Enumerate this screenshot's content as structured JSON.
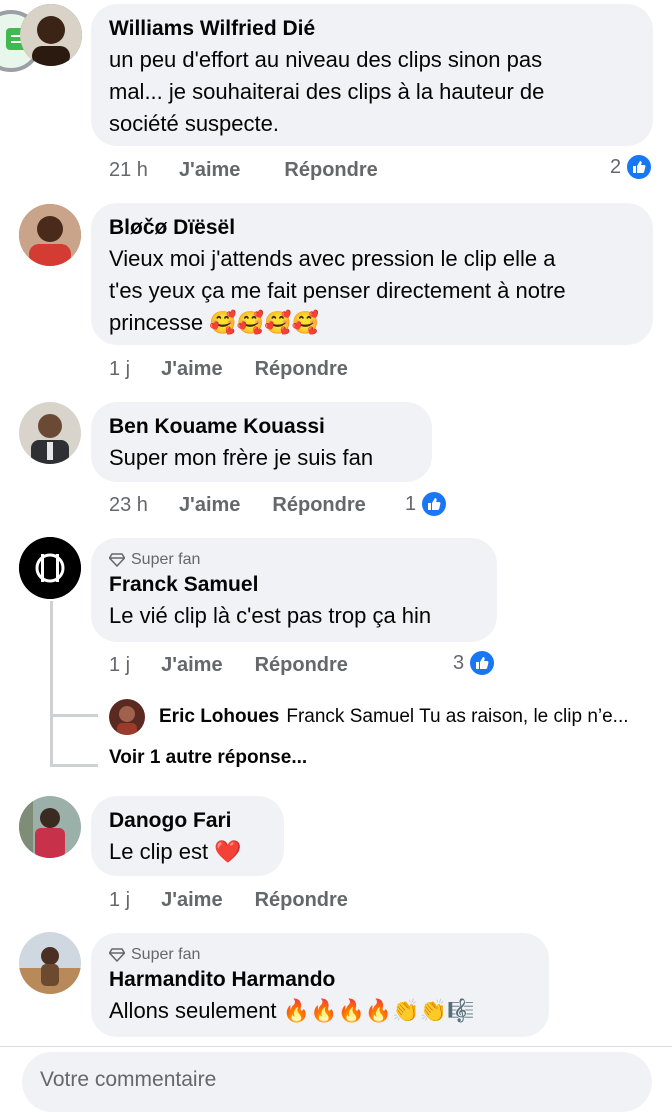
{
  "colors": {
    "like_blue": "#1877f2",
    "bubble": "#f0f2f5",
    "secondary_text": "#65676b"
  },
  "comments": [
    {
      "author": "Williams Wilfried Dié",
      "text_lines": [
        "un peu d'effort au niveau des clips sinon pas",
        "mal... je souhaiterai des clips à la hauteur de",
        "société suspecte."
      ],
      "time": "21 h",
      "like_label": "J'aime",
      "reply_label": "Répondre",
      "reactions": "2"
    },
    {
      "author": "Bløčø Dïësël",
      "text_lines": [
        "Vieux moi j'attends avec pression le clip elle a",
        "t'es yeux ça me fait penser directement à notre",
        "princesse"
      ],
      "emoji": "🥰🥰🥰🥰",
      "time": "1 j",
      "like_label": "J'aime",
      "reply_label": "Répondre"
    },
    {
      "author": "Ben Kouame Kouassi",
      "text": "Super mon frère je suis fan",
      "time": "23 h",
      "like_label": "J'aime",
      "reply_label": "Répondre",
      "reactions": "1"
    },
    {
      "badge": "Super fan",
      "author": "Franck Samuel",
      "text": "Le vié clip là c'est pas trop ça hin",
      "time": "1 j",
      "like_label": "J'aime",
      "reply_label": "Répondre",
      "reactions": "3",
      "reply_preview": {
        "author": "Eric Lohoues",
        "text": "Franck Samuel Tu as raison, le clip n’e..."
      },
      "more_replies": "Voir 1 autre réponse..."
    },
    {
      "author": "Danogo Fari",
      "text": "Le clip est",
      "emoji": "❤️",
      "time": "1 j",
      "like_label": "J'aime",
      "reply_label": "Répondre"
    },
    {
      "badge": "Super fan",
      "author": "Harmandito Harmando",
      "text": "Allons seulement",
      "emoji": "🔥🔥🔥🔥👏👏🎼"
    }
  ],
  "composer": {
    "placeholder": "Votre commentaire"
  }
}
